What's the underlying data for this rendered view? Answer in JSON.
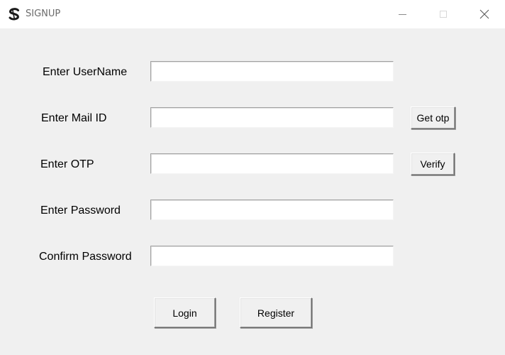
{
  "window": {
    "title": "SIGNUP",
    "icon": "app-logo-icon",
    "controls": {
      "minimize_icon": "minimize-icon",
      "maximize_icon": "maximize-icon",
      "close_icon": "close-icon"
    }
  },
  "form": {
    "username": {
      "label": "Enter UserName",
      "value": ""
    },
    "mail": {
      "label": "Enter Mail ID",
      "value": "",
      "button_label": "Get otp"
    },
    "otp": {
      "label": "Enter OTP",
      "value": "",
      "button_label": "Verify"
    },
    "password": {
      "label": "Enter Password",
      "value": ""
    },
    "confirm_password": {
      "label": "Confirm Password",
      "value": ""
    }
  },
  "actions": {
    "login_label": "Login",
    "register_label": "Register"
  },
  "colors": {
    "window_bg": "#f0f0f0",
    "titlebar_bg": "#ffffff",
    "title_text": "#6b6b6b"
  }
}
